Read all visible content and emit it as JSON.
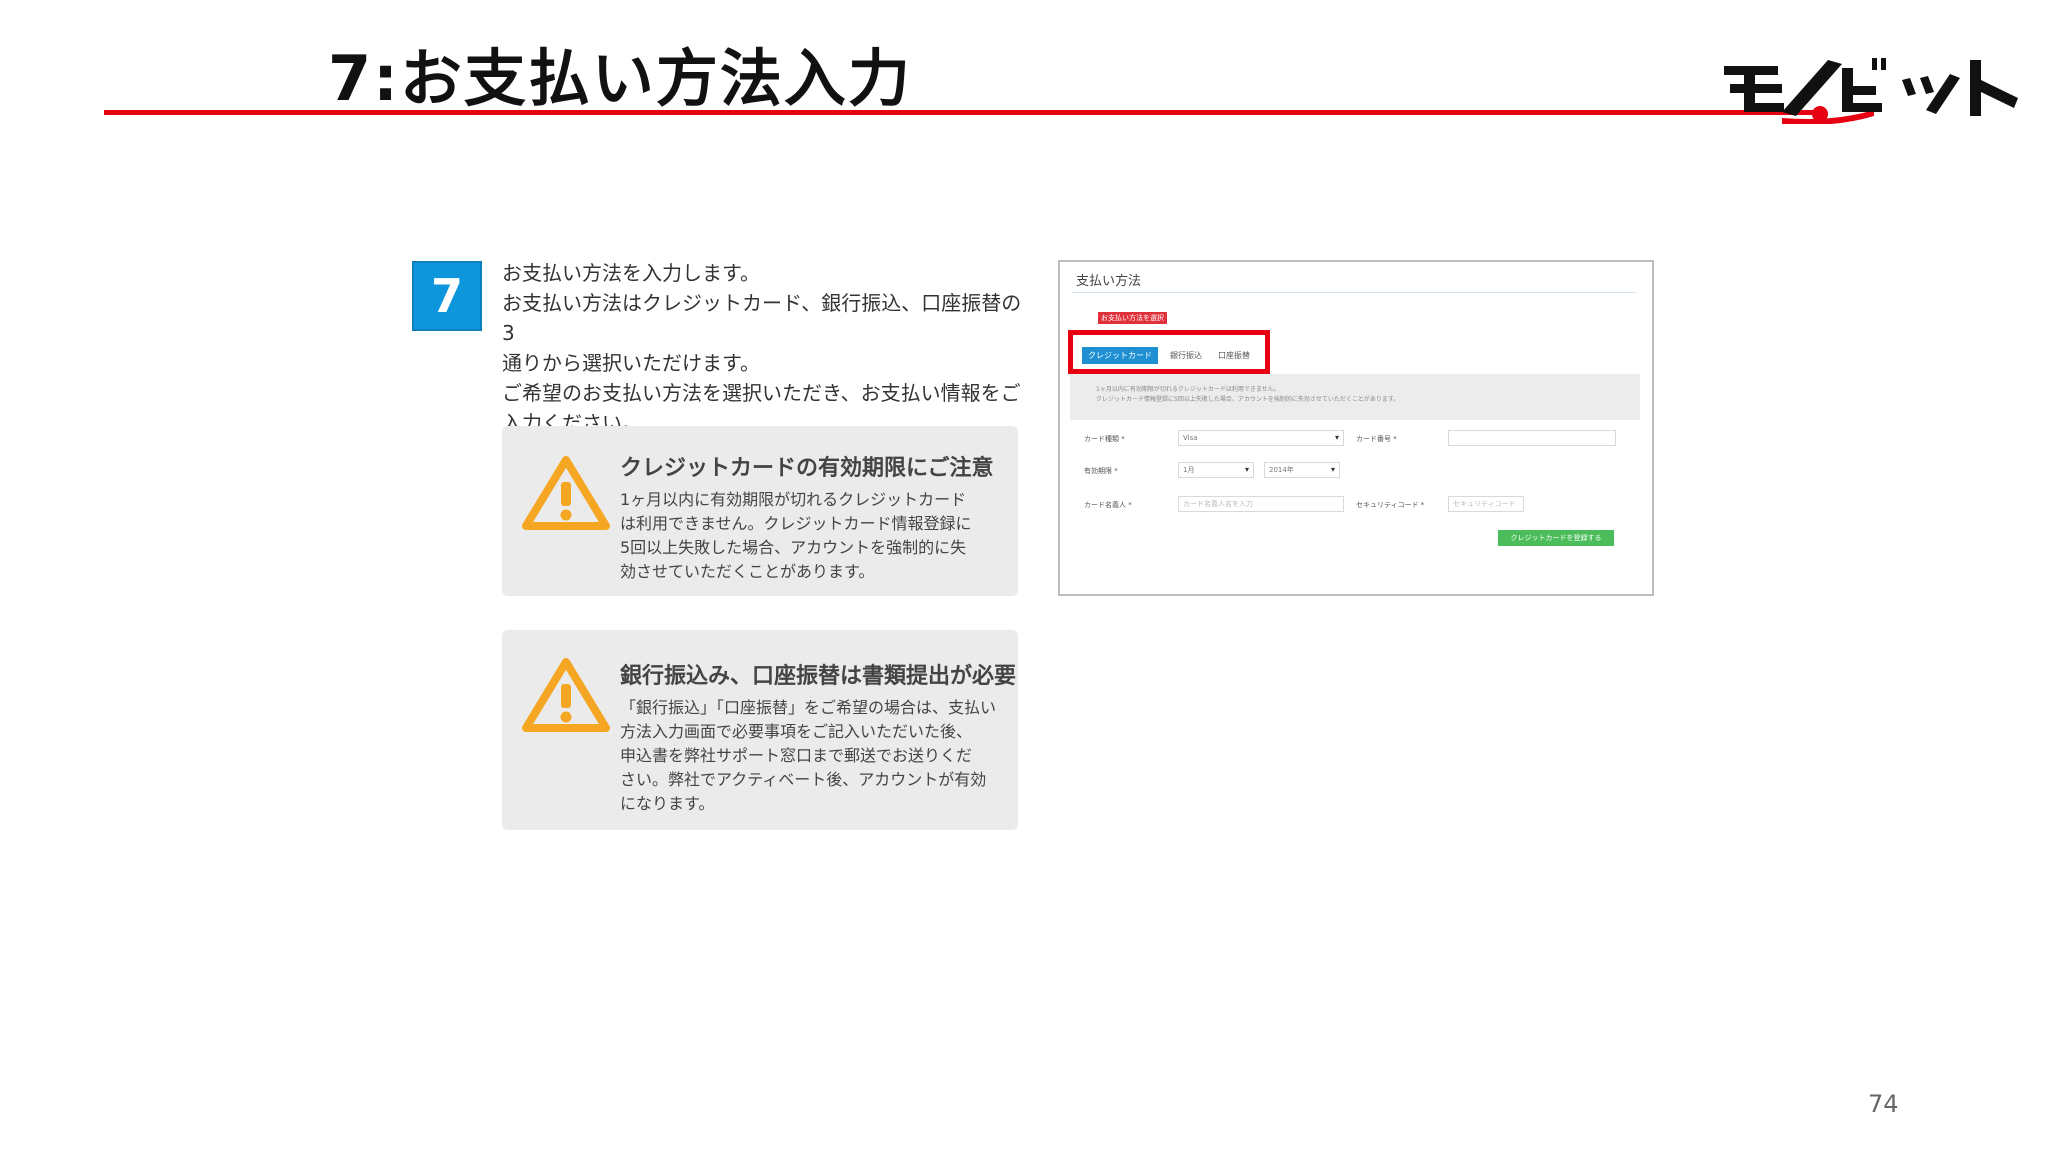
{
  "slide": {
    "title": "7:お支払い方法入力",
    "page_number": "74",
    "accent_color": "#e60012"
  },
  "logo": {
    "text": "モノビット",
    "icon": "monobit-logo"
  },
  "step": {
    "number": "7",
    "badge_color": "#0e96dc",
    "lines": [
      "お支払い方法を入力します。",
      "お支払い方法はクレジットカード、銀行振込、口座振替の3",
      "通りから選択いただけます。",
      "ご希望のお支払い方法を選択いただき、お支払い情報をご",
      "入力ください。"
    ]
  },
  "notices": [
    {
      "icon": "warning-icon",
      "title": "クレジットカードの有効期限にご注意",
      "lines": [
        "1ヶ月以内に有効期限が切れるクレジットカード",
        "は利用できません。クレジットカード情報登録に",
        "5回以上失敗した場合、アカウントを強制的に失",
        "効させていただくことがあります。"
      ]
    },
    {
      "icon": "warning-icon",
      "title": "銀行振込み、口座振替は書類提出が必要",
      "lines": [
        "「銀行振込」「口座振替」をご希望の場合は、支払い",
        "方法入力画面で必要事項をご記入いただいた後、",
        "申込書を弊社サポート窓口まで郵送でお送りくだ",
        "さい。弊社でアクティベート後、アカウントが有効",
        "になります。"
      ]
    }
  ],
  "form": {
    "title": "支払い方法",
    "required_badge": "お支払い方法を選択",
    "tabs": [
      "クレジットカード",
      "銀行振込",
      "口座振替"
    ],
    "info_lines": [
      "1ヶ月以内に有効期限が切れるクレジットカードは利用できません。",
      "クレジットカード情報登録に5回以上失敗した場合、アカウントを強制的に失効させていただくことがあります。"
    ],
    "labels": {
      "card_type": "カード種類 *",
      "card_number": "カード番号 *",
      "expiry": "有効期限 *",
      "holder": "カード名義人 *",
      "security": "セキュリティコード *"
    },
    "values": {
      "card_type": "Visa",
      "month": "1月",
      "year": "2014年"
    },
    "placeholders": {
      "holder": "カード名義人名を入力",
      "security": "セキュリティコード"
    },
    "submit_label": "クレジットカードを登録する"
  }
}
